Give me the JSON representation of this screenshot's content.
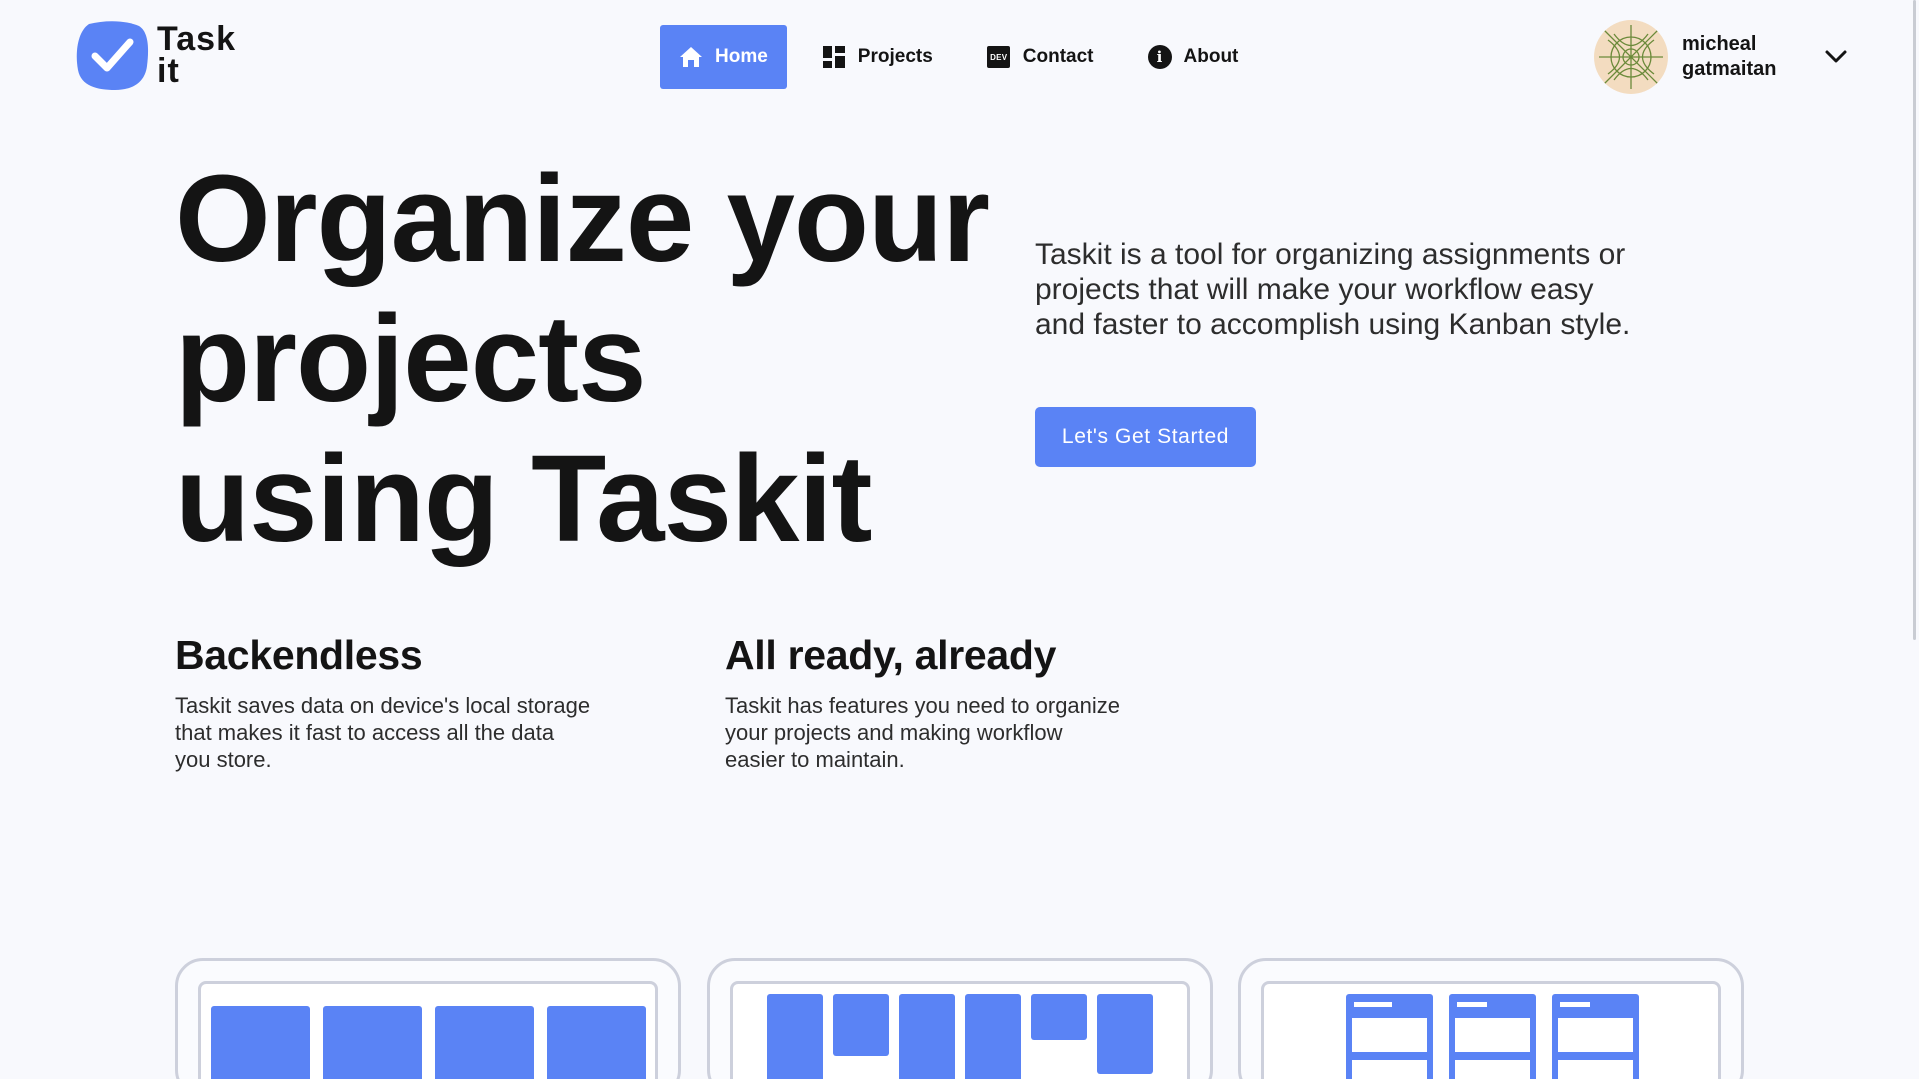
{
  "brand": {
    "logo_line1": "Task",
    "logo_line2": "it",
    "accent_color": "#5a83f5",
    "logo_icon": "checkmark-badge-icon"
  },
  "nav": {
    "items": [
      {
        "label": "Home",
        "icon": "home-icon",
        "active": true
      },
      {
        "label": "Projects",
        "icon": "grid-icon",
        "active": false
      },
      {
        "label": "Contact",
        "icon": "dev-badge-icon",
        "active": false
      },
      {
        "label": "About",
        "icon": "info-icon",
        "active": false
      }
    ]
  },
  "user": {
    "first_name": "micheal",
    "last_name": "gatmaitan",
    "dropdown_icon": "chevron-down-icon"
  },
  "hero": {
    "title": "Organize your projects using Taskit",
    "description": "Taskit is a tool for organizing assignments or projects that will make your workflow easy and faster to accomplish using Kanban style.",
    "cta_label": "Let's Get Started"
  },
  "features": [
    {
      "title": "Backendless",
      "text": "Taskit saves data on device's local storage that makes it fast to access all the data you store."
    },
    {
      "title": "All ready, already",
      "text": "Taskit has features you need to organize your projects and making workflow easier to maintain."
    }
  ]
}
